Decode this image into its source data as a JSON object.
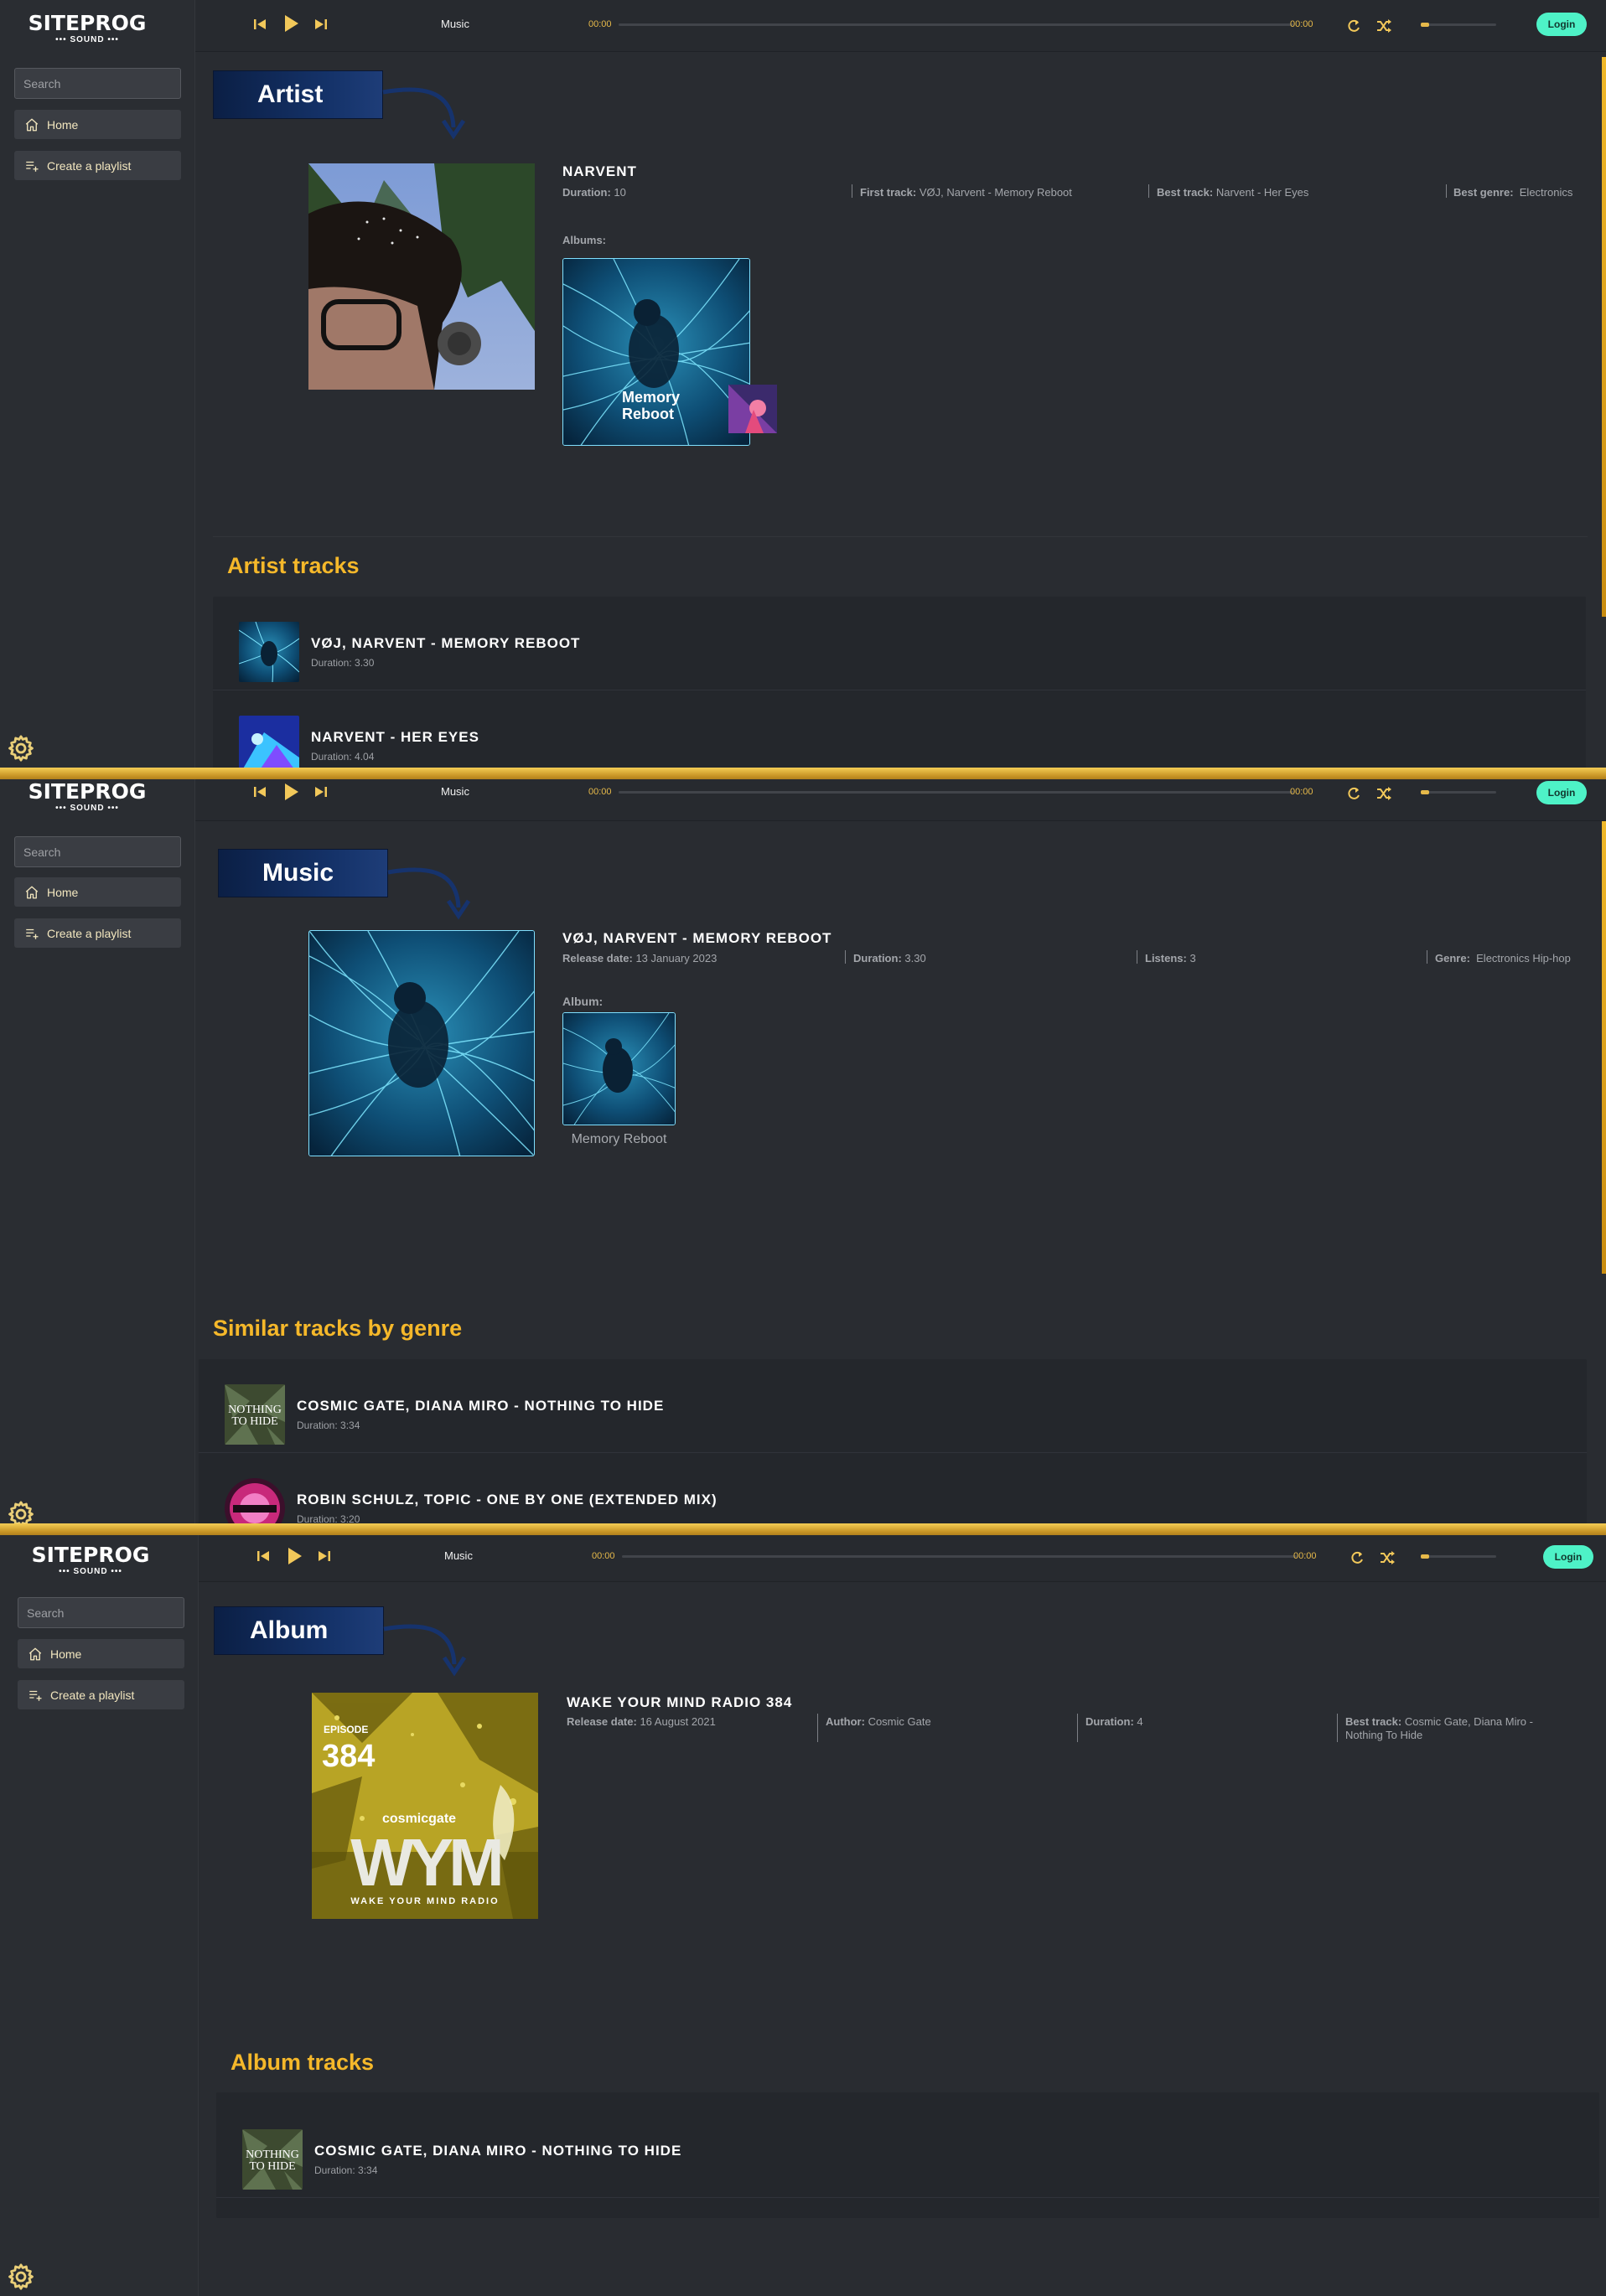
{
  "app": {
    "logo_main": "SITEPROG",
    "logo_sub": "••• SOUND •••",
    "search_placeholder": "Search",
    "nav_home": "Home",
    "nav_create_playlist": "Create a playlist",
    "player_label": "Music",
    "time_current": "00:00",
    "time_total": "00:00",
    "login_label": "Login",
    "volume_level": 0.1,
    "colors": {
      "accent_gold": "#f5b82a",
      "login_teal": "#4ef2c7",
      "banner_navy": "#0b1f45"
    }
  },
  "artist_page": {
    "banner": "Artist",
    "name": "NARVENT",
    "duration_label": "Duration:",
    "duration_value": "10",
    "first_track_label": "First track:",
    "first_track_value": "VØJ, Narvent - Memory Reboot",
    "best_track_label": "Best track:",
    "best_track_value": "Narvent - Her Eyes",
    "best_genre_label": "Best genre:",
    "best_genre_value": "Electronics",
    "albums_label": "Albums:",
    "album_overlay": "Memory Reboot",
    "section_title": "Artist tracks",
    "tracks": [
      {
        "name": "VØJ, NARVENT - MEMORY REBOOT",
        "duration": "Duration: 3.30"
      },
      {
        "name": "NARVENT - HER EYES",
        "duration": "Duration: 4.04"
      }
    ]
  },
  "music_page": {
    "banner": "Music",
    "name": "VØJ, NARVENT - MEMORY REBOOT",
    "release_label": "Release date:",
    "release_value": "13 January 2023",
    "duration_label": "Duration:",
    "duration_value": "3.30",
    "listens_label": "Listens:",
    "listens_value": "3",
    "genre_label": "Genre:",
    "genre_value": "Electronics Hip-hop",
    "album_label": "Album:",
    "album_caption": "Memory Reboot",
    "section_title": "Similar tracks by genre",
    "tracks": [
      {
        "name": "COSMIC GATE, DIANA MIRO - NOTHING TO HIDE",
        "duration": "Duration: 3:34"
      },
      {
        "name": "ROBIN SCHULZ, TOPIC - ONE BY ONE (EXTENDED MIX)",
        "duration": "Duration: 3:20"
      }
    ]
  },
  "album_page": {
    "banner": "Album",
    "name": "WAKE YOUR MIND RADIO 384",
    "release_label": "Release date:",
    "release_value": "16 August 2021",
    "author_label": "Author:",
    "author_value": "Cosmic Gate",
    "duration_label": "Duration:",
    "duration_value": "4",
    "best_track_label": "Best track:",
    "best_track_value": "Cosmic Gate, Diana Miro - Nothing To Hide",
    "cover_episode": "EPISODE",
    "cover_number": "384",
    "cover_brand": "cosmicgate",
    "cover_logo": "WYM",
    "cover_tagline": "WAKE YOUR MIND RADIO",
    "section_title": "Album tracks",
    "tracks": [
      {
        "name": "COSMIC GATE, DIANA MIRO - NOTHING TO HIDE",
        "duration": "Duration: 3:34"
      }
    ]
  }
}
